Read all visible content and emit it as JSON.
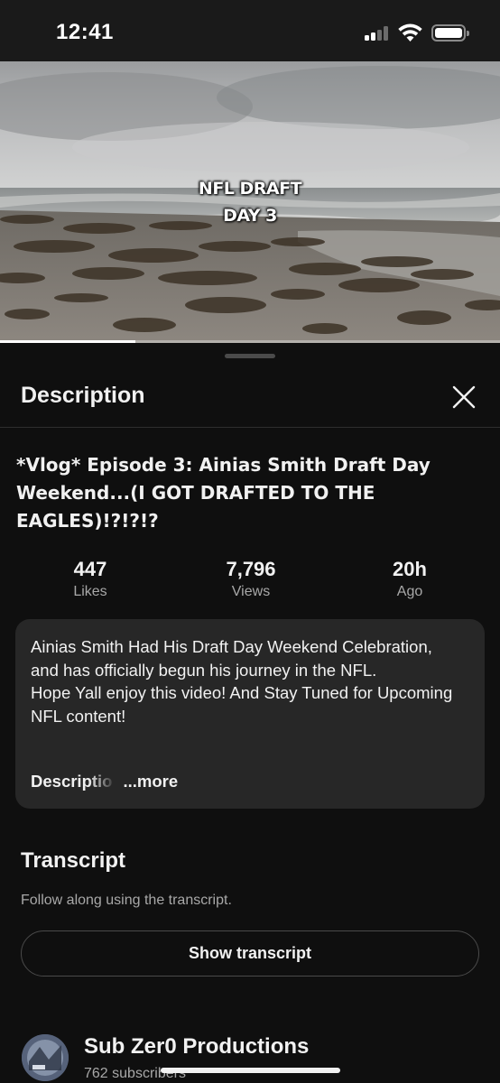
{
  "status_bar": {
    "time": "12:41"
  },
  "video": {
    "caption_line1": "NFL DRAFT",
    "caption_line2": "DAY 3",
    "progress": 0.27
  },
  "sheet": {
    "title": "Description",
    "close_icon": "close-icon"
  },
  "video_title": "*Vlog* Episode 3: Ainias Smith Draft Day Weekend...(I GOT DRAFTED TO THE EAGLES)!?!?!?",
  "stats": [
    {
      "value": "447",
      "label": "Likes"
    },
    {
      "value": "7,796",
      "label": "Views"
    },
    {
      "value": "20h",
      "label": "Ago"
    }
  ],
  "description": {
    "line1": "Ainias Smith Had His Draft Day Weekend Celebration, and has officially begun his journey in the NFL.",
    "line2": "Hope Yall enjoy this video! And Stay Tuned for Upcoming NFL content!",
    "truncated": "Descriptio",
    "more": "...more"
  },
  "transcript": {
    "title": "Transcript",
    "subtitle": "Follow along using the transcript.",
    "button": "Show transcript"
  },
  "channel": {
    "name": "Sub Zer0 Productions",
    "subscribers": "762 subscribers"
  }
}
